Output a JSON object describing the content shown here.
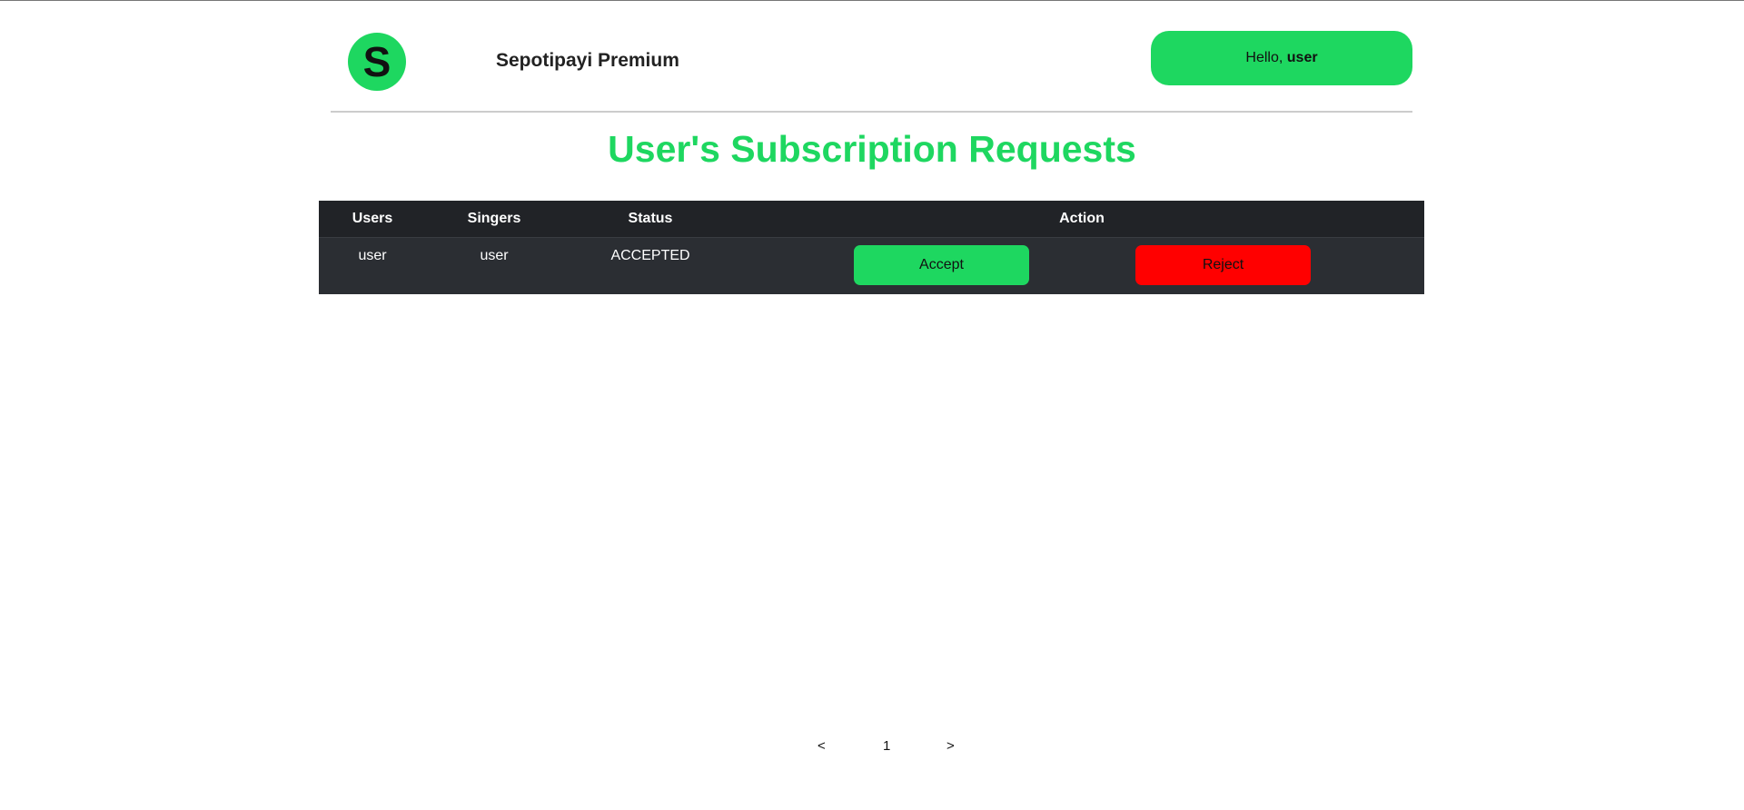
{
  "header": {
    "logo_letter": "S",
    "brand": "Sepotipayi Premium",
    "greeting": "Hello, ",
    "username": "user"
  },
  "page_title": "User's Subscription Requests",
  "table": {
    "columns": [
      "Users",
      "Singers",
      "Status",
      "Action"
    ],
    "rows": [
      {
        "user": "user",
        "singer": "user",
        "status": "ACCEPTED",
        "accept_label": "Accept",
        "reject_label": "Reject"
      }
    ]
  },
  "pagination": {
    "prev": "<",
    "current": "1",
    "next": ">"
  },
  "colors": {
    "accent": "#1ed760",
    "reject": "#ff0000",
    "header_bg": "#212327",
    "row_bg": "#2b2e33"
  }
}
